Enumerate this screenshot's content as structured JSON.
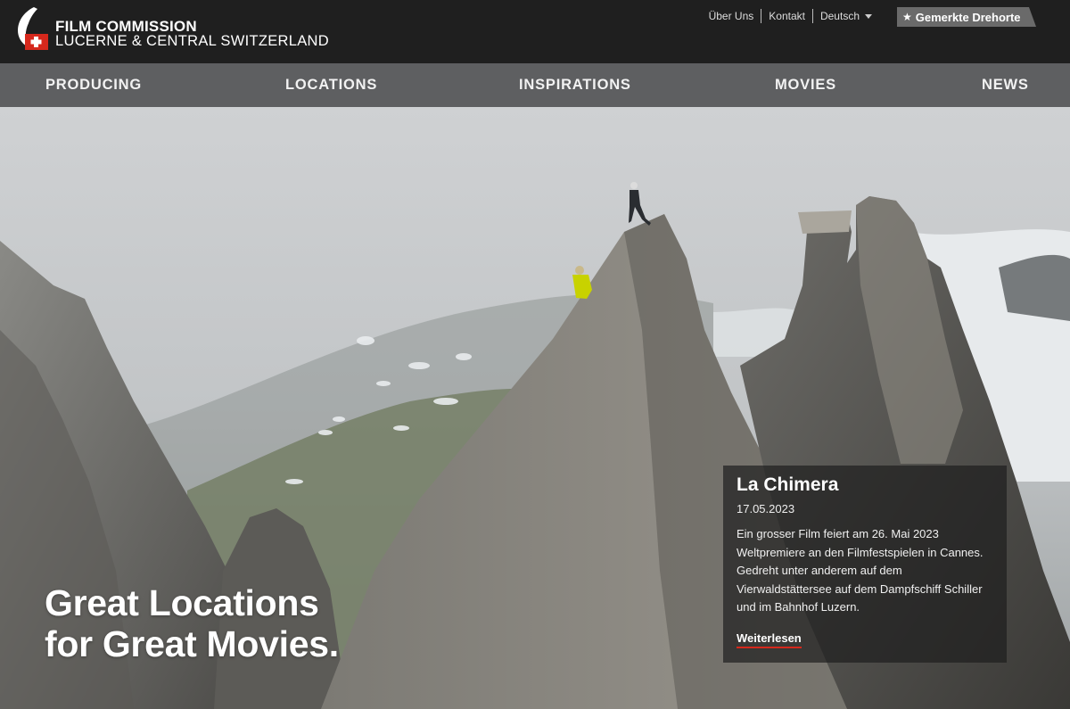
{
  "brand": {
    "line1": "FILM COMMISSION",
    "line2": "LUCERNE & CENTRAL SWITZERLAND",
    "logo_colors": {
      "white": "#ffffff",
      "red": "#d6281c"
    }
  },
  "utility_nav": {
    "about": "Über Uns",
    "contact": "Kontakt",
    "language": "Deutsch"
  },
  "bookmarks": {
    "label": "Gemerkte Drehorte",
    "icon": "star-icon"
  },
  "main_nav": [
    {
      "label": "PRODUCING"
    },
    {
      "label": "LOCATIONS"
    },
    {
      "label": "INSPIRATIONS"
    },
    {
      "label": "MOVIES"
    },
    {
      "label": "NEWS"
    }
  ],
  "hero": {
    "tagline_line1": "Great Locations",
    "tagline_line2": "for Great Movies."
  },
  "news_card": {
    "title": "La Chimera",
    "date": "17.05.2023",
    "body": "Ein grosser Film feiert am 26. Mai 2023 Weltpremiere an den Filmfestspielen in Cannes. Gedreht unter anderem auf dem Vierwaldstättersee auf dem Dampfschiff Schiller und im Bahnhof Luzern.",
    "link": "Weiterlesen"
  },
  "colors": {
    "header_bg": "#1f1f1f",
    "nav_bg": "#5e5f61",
    "accent_red": "#d6281c"
  }
}
